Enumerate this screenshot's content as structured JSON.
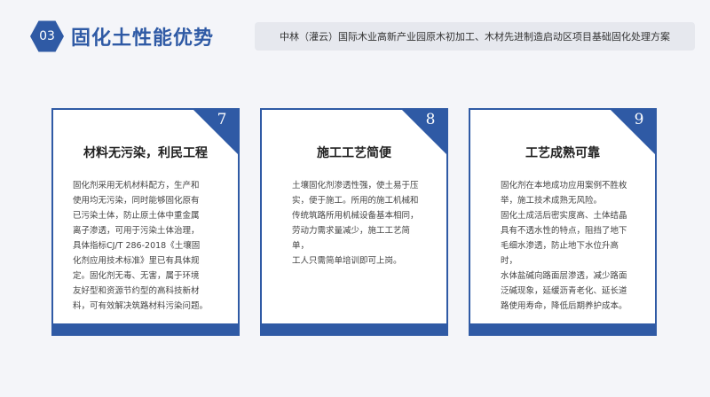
{
  "header": {
    "number": "03",
    "title": "固化土性能优势",
    "subtitle": "中林（灌云）国际木业高新产业园原木初加工、木材先进制造启动区项目基础固化处理方案"
  },
  "cards": [
    {
      "number": "7",
      "title": "材料无污染，利民工程",
      "body": "固化剂采用无机材料配方，生产和\n使用均无污染，同时能够固化原有\n已污染土体，防止原土体中重金属\n离子渗透，可用于污染土体治理，\n具体指标CJ/T 286-2018《土壤固\n化剂应用技术标准》里已有具体规\n定。固化剂无毒、无害，属于环境\n友好型和资源节约型的高科技新材\n料，可有效解决筑路材料污染问题。"
    },
    {
      "number": "8",
      "title": "施工工艺简便",
      "body": "土壤固化剂渗透性强，使土易于压\n实，便于施工。所用的施工机械和\n传统筑路所用机械设备基本相同，\n劳动力需求量减少，施工工艺简单，\n工人只需简单培训即可上岗。"
    },
    {
      "number": "9",
      "title": "工艺成熟可靠",
      "body": "固化剂在本地成功应用案例不胜枚\n举，施工技术成熟无风险。\n固化土成活后密实度高、土体结晶\n具有不透水性的特点，阻挡了地下\n毛细水渗透，防止地下水位升高时，\n水体盐碱向路面层渗透，减少路面\n泛碱现象，延缓沥青老化、延长道\n路使用寿命，降低后期养护成本。"
    }
  ],
  "colors": {
    "accent": "#2f5aa5",
    "background": "#f4f5f9"
  }
}
